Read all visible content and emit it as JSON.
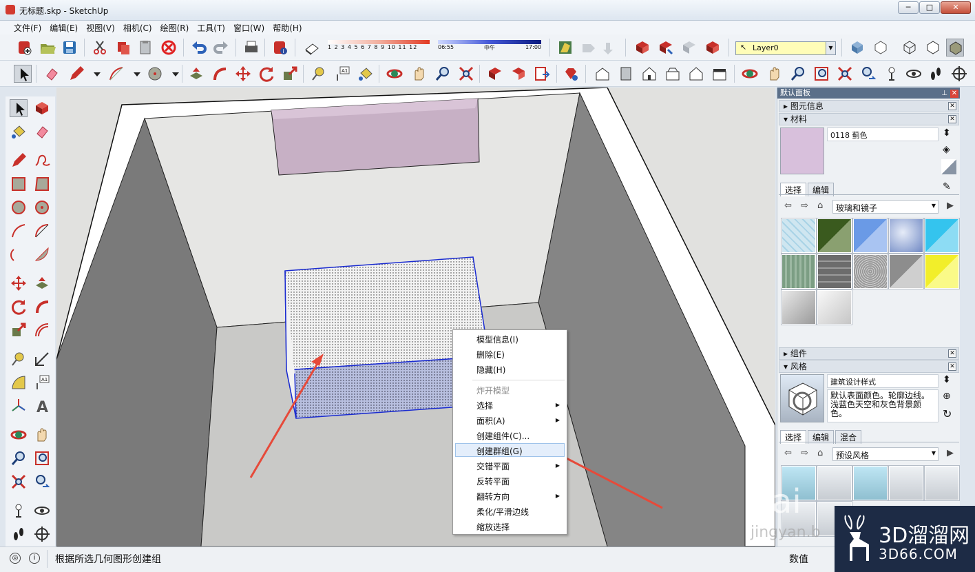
{
  "window": {
    "title": "无标题.skp - SketchUp",
    "min": "─",
    "max": "□",
    "close": "✕"
  },
  "menu": [
    "文件(F)",
    "编辑(E)",
    "视图(V)",
    "相机(C)",
    "绘图(R)",
    "工具(T)",
    "窗口(W)",
    "帮助(H)"
  ],
  "shadow": {
    "months": "1 2 3 4 5 6 7 8 9 10 11 12",
    "time_start": "06:55",
    "time_mid": "中午",
    "time_end": "17:00"
  },
  "layer": {
    "value": "Layer0"
  },
  "panel": {
    "title": "默认面板",
    "entity_info": "图元信息",
    "materials": {
      "header": "材料",
      "name": "0118 蓟色",
      "color": "#d8c0dc",
      "tabs": [
        "选择",
        "编辑"
      ],
      "collection": "玻璃和镜子",
      "swatches": [
        "#cfe6f0",
        "#3a5a1e",
        "#6a9ae6",
        "#8ea6d8",
        "#34c4ee",
        "#7c9e84",
        "#6c6c6c",
        "#b8b8b8",
        "#8d8d8d",
        "#f2ee2a",
        "#cfcfcf",
        "#e6e6e6"
      ]
    },
    "components": "组件",
    "styles": {
      "header": "风格",
      "name": "建筑设计样式",
      "description": "默认表面颜色。轮廓边线。浅蓝色天空和灰色背景颜色。",
      "tabs": [
        "选择",
        "编辑",
        "混合"
      ],
      "collection": "预设风格"
    }
  },
  "context_menu": {
    "items": [
      {
        "label": "模型信息(I)",
        "disabled": false,
        "submenu": false
      },
      {
        "label": "删除(E)",
        "disabled": false,
        "submenu": false
      },
      {
        "label": "隐藏(H)",
        "disabled": false,
        "submenu": false
      },
      {
        "label": "炸开模型",
        "disabled": true,
        "submenu": false
      },
      {
        "label": "选择",
        "disabled": false,
        "submenu": true
      },
      {
        "label": "面积(A)",
        "disabled": false,
        "submenu": true
      },
      {
        "label": "创建组件(C)...",
        "disabled": false,
        "submenu": false
      },
      {
        "label": "创建群组(G)",
        "disabled": false,
        "submenu": false,
        "highlighted": true
      },
      {
        "label": "交错平面",
        "disabled": false,
        "submenu": true
      },
      {
        "label": "反转平面",
        "disabled": false,
        "submenu": false
      },
      {
        "label": "翻转方向",
        "disabled": false,
        "submenu": true
      },
      {
        "label": "柔化/平滑边线",
        "disabled": false,
        "submenu": false
      },
      {
        "label": "缩放选择",
        "disabled": false,
        "submenu": false
      }
    ]
  },
  "status": {
    "message": "根据所选几何图形创建组",
    "value_label": "数值"
  },
  "watermark": {
    "brand": "3D溜溜网",
    "domain": "3D66.COM",
    "baidu": "Bai",
    "jingyan": "jingyan.b"
  }
}
